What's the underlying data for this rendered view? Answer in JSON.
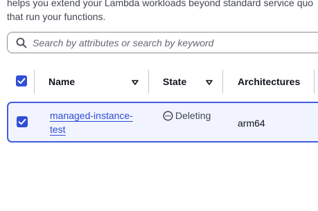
{
  "description": {
    "line1": "helps you extend your Lambda workloads beyond standard service quo",
    "line2": "that run your functions."
  },
  "search": {
    "placeholder": "Search by attributes or search by keyword",
    "icon": "search-icon"
  },
  "table": {
    "select_all_checked": true,
    "columns": [
      {
        "label": "Name",
        "sortable": true
      },
      {
        "label": "State",
        "sortable": true
      },
      {
        "label": "Architectures",
        "sortable": false
      }
    ],
    "rows": [
      {
        "selected": true,
        "name": "managed-instance-test",
        "state": "Deleting",
        "state_icon": "ellipsis-circle-icon",
        "architecture": "arm64"
      }
    ]
  },
  "colors": {
    "accent": "#2f4fd6",
    "link": "#2e4bd3",
    "selected_row_bg": "#f1f4ff",
    "selected_row_border": "#3f5ce0"
  }
}
